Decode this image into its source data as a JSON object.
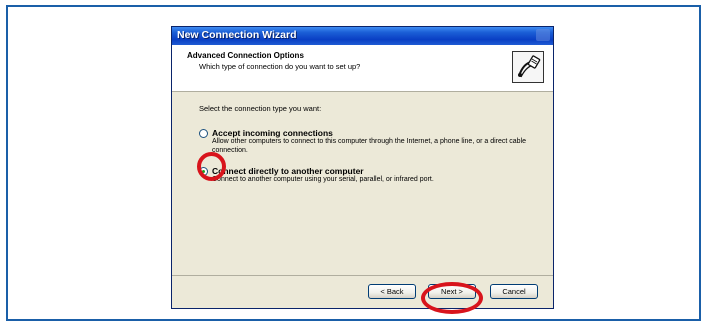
{
  "window": {
    "title": "New Connection Wizard"
  },
  "header": {
    "title": "Advanced Connection Options",
    "subtitle": "Which type of connection do you want to set up?",
    "icon": "network-cable-icon"
  },
  "content": {
    "prompt": "Select the connection type you want:",
    "options": [
      {
        "label": "Accept incoming connections",
        "description": "Allow other computers to connect to this computer through the Internet, a phone line, or a direct cable connection.",
        "selected": false
      },
      {
        "label": "Connect directly to another computer",
        "description": "Connect to another computer using your serial, parallel, or infrared port.",
        "selected": true
      }
    ]
  },
  "footer": {
    "back_label": "< Back",
    "next_label": "Next >",
    "cancel_label": "Cancel"
  },
  "colors": {
    "highlight": "#d8141c",
    "frame": "#1a5fa8",
    "titlebar": "#0a3fc4"
  }
}
